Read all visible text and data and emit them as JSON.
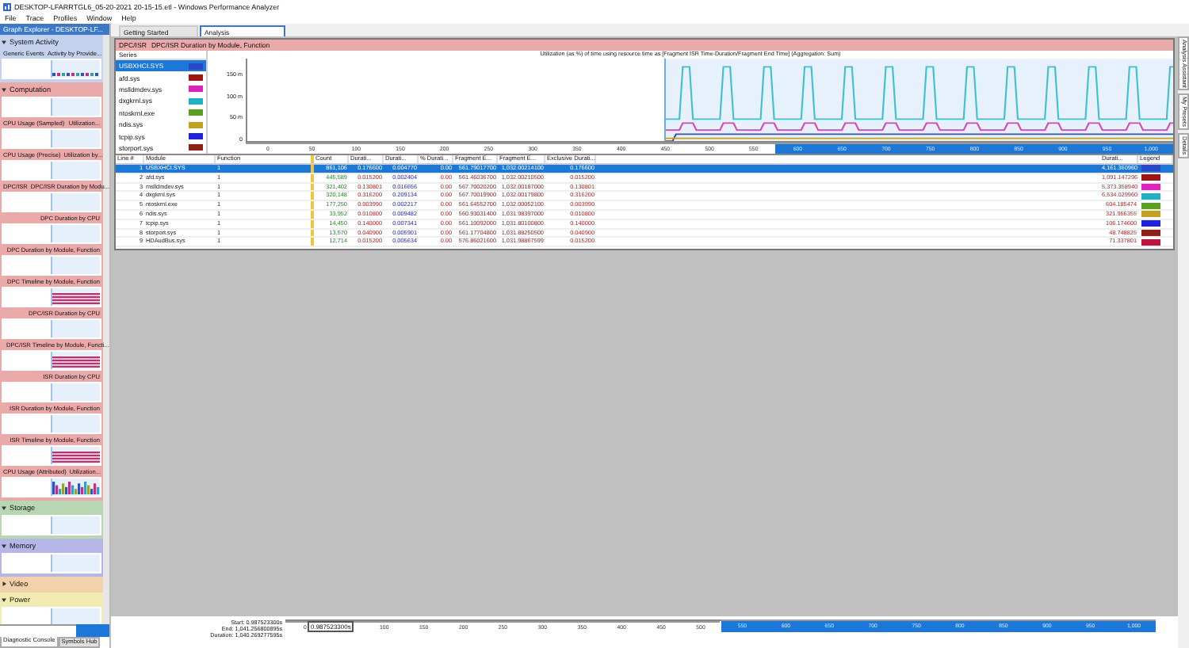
{
  "window": {
    "title": "DESKTOP-LFARRTGL6_05-20-2021 20-15-15.etl - Windows Performance Analyzer"
  },
  "menu": [
    "File",
    "Trace",
    "Profiles",
    "Window",
    "Help"
  ],
  "graph_explorer": {
    "title": "Graph Explorer - DESKTOP-LF...",
    "sections": [
      {
        "name": "System Activity",
        "expanded": true,
        "color": "#c4d2ee",
        "graphs": [
          {
            "title": "Generic Events",
            "subtitle": "Activity by Provide...",
            "kind": "activity"
          }
        ]
      },
      {
        "name": "Computation",
        "expanded": true,
        "color": "#eaaaaa",
        "graphs": [
          {
            "kind": "empty"
          },
          {
            "title": "CPU Usage (Sampled)",
            "subtitle": "Utilization...",
            "kind": "empty"
          },
          {
            "title": "CPU Usage (Precise)",
            "subtitle": "Utilization by...",
            "kind": "empty"
          },
          {
            "title": "DPC/ISR",
            "subtitle": "DPC/ISR Duration by Modu...",
            "kind": "empty"
          },
          {
            "subtitle": "DPC Duration by CPU",
            "kind": "empty"
          },
          {
            "subtitle": "DPC Duration by Module, Function",
            "kind": "empty"
          },
          {
            "subtitle": "DPC Timeline by Module, Function",
            "kind": "stripes"
          },
          {
            "subtitle": "DPC/ISR Duration by CPU",
            "kind": "empty"
          },
          {
            "subtitle": "DPC/ISR Timeline by Module, Functi...",
            "kind": "stripes"
          },
          {
            "subtitle": "ISR Duration by CPU",
            "kind": "empty"
          },
          {
            "subtitle": "ISR Duration by Module, Function",
            "kind": "empty"
          },
          {
            "subtitle": "ISR Timeline by Module, Function",
            "kind": "stripes"
          },
          {
            "title": "CPU Usage (Attributed)",
            "subtitle": "Utilization...",
            "kind": "bars"
          }
        ]
      },
      {
        "name": "Storage",
        "expanded": true,
        "color": "#b9d6b2",
        "graphs": [
          {
            "kind": "empty"
          }
        ]
      },
      {
        "name": "Memory",
        "expanded": true,
        "color": "#b6b6e6",
        "graphs": [
          {
            "kind": "empty"
          }
        ]
      },
      {
        "name": "Video",
        "expanded": false,
        "color": "#f2d2aa"
      },
      {
        "name": "Power",
        "expanded": true,
        "color": "#f2ecb2",
        "graphs": [
          {
            "kind": "empty"
          }
        ]
      }
    ]
  },
  "bottom_tabs": [
    {
      "label": "Diagnostic Console",
      "selected": true
    },
    {
      "label": "Symbols Hub",
      "selected": false
    }
  ],
  "tabs": [
    {
      "label": "Getting Started",
      "selected": false
    },
    {
      "label": "Analysis",
      "selected": true
    }
  ],
  "analysis": {
    "graph_title": "DPC/ISR",
    "graph_subtitle": "DPC/ISR Duration by Module, Function",
    "series_header": "Series",
    "series": [
      {
        "name": "USBXHCI.SYS",
        "color": "#2a48c8",
        "selected": true
      },
      {
        "name": "afd.sys",
        "color": "#a01414",
        "selected": false
      },
      {
        "name": "mslldmdev.sys",
        "color": "#e020c0",
        "selected": false
      },
      {
        "name": "dxgkrnl.sys",
        "color": "#20b0c4",
        "selected": false
      },
      {
        "name": "ntoskrnl.exe",
        "color": "#58a020",
        "selected": false
      },
      {
        "name": "ndis.sys",
        "color": "#c4a020",
        "selected": false
      },
      {
        "name": "tcpip.sys",
        "color": "#2020e0",
        "selected": false
      },
      {
        "name": "storport.sys",
        "color": "#902014",
        "selected": false
      }
    ],
    "chart": {
      "title": "Utilization (as %) of time using resource time as [Fragment ISR Time-Duration/Fragment End Time] (Aggregation: Sum)",
      "y_ticks": [
        "150 m",
        "100 m",
        "50 m",
        "0"
      ],
      "x_ticks": [
        "0",
        "50",
        "100",
        "150",
        "200",
        "250",
        "300",
        "350",
        "400",
        "450",
        "500",
        "550",
        "600",
        "650",
        "700",
        "750",
        "800",
        "850",
        "900",
        "950",
        "1,000"
      ]
    },
    "table": {
      "columns": [
        "Line #",
        "Module",
        "Function",
        "Count",
        "Durati...",
        "Durati...",
        "% Durati...",
        "Fragment E...",
        "Fragment E...",
        "Exclusive Durati...",
        "Durati...",
        "Legend"
      ],
      "rows": [
        {
          "selected": true,
          "color": "#2a48c8",
          "cells": [
            "1",
            "USBXHCI.SYS",
            "1",
            "861,106",
            "0.176600",
            "0.004770",
            "0.00",
            "561.79017700",
            "1,032.00214100",
            "0.176600",
            "4,161.360960"
          ]
        },
        {
          "selected": false,
          "color": "#a01414",
          "cells": [
            "2",
            "afd.sys",
            "1",
            "445,589",
            "0.015200",
            "0.002404",
            "0.00",
            "561.46036700",
            "1,032.00210500",
            "0.015200",
            "1,091.147296"
          ]
        },
        {
          "selected": false,
          "color": "#e020c0",
          "cells": [
            "3",
            "mslldmdev.sys",
            "1",
            "321,402",
            "0.130801",
            "0.016656",
            "0.00",
            "567.70020200",
            "1,032.00187000",
            "0.130801",
            "5,373.358940"
          ]
        },
        {
          "selected": false,
          "color": "#20b0c4",
          "cells": [
            "4",
            "dxgkrnl.sys",
            "1",
            "320,148",
            "0.316200",
            "0.209134",
            "0.00",
            "567.70019900",
            "1,032.00179800",
            "0.316200",
            "6,534.029960"
          ]
        },
        {
          "selected": false,
          "color": "#58a020",
          "cells": [
            "5",
            "ntoskrnl.exe",
            "1",
            "177,250",
            "0.003990",
            "0.002217",
            "0.00",
            "561.64552700",
            "1,032.00052100",
            "0.003990",
            "604.185474"
          ]
        },
        {
          "selected": false,
          "color": "#c4a020",
          "cells": [
            "6",
            "ndis.sys",
            "1",
            "33,952",
            "0.010800",
            "0.009482",
            "0.00",
            "560.93031400",
            "1,031.98397000",
            "0.010800",
            "321.956355"
          ]
        },
        {
          "selected": false,
          "color": "#2020e0",
          "cells": [
            "7",
            "tcpip.sys",
            "1",
            "14,450",
            "0.140000",
            "0.007341",
            "0.00",
            "561.10092000",
            "1,031.80100800",
            "0.140000",
            "106.174600"
          ]
        },
        {
          "selected": false,
          "color": "#902014",
          "cells": [
            "8",
            "storport.sys",
            "1",
            "13,570",
            "0.040900",
            "0.005901",
            "0.00",
            "561.17704800",
            "1,031.88250500",
            "0.040900",
            "48.748825"
          ]
        },
        {
          "selected": false,
          "color": "#c01440",
          "cells": [
            "9",
            "HDAudBus.sys",
            "1",
            "12,714",
            "0.015200",
            "0.005634",
            "0.00",
            "576.86021600",
            "1,031.98867599",
            "0.015200",
            "71.337801"
          ]
        }
      ]
    }
  },
  "timeline": {
    "labels": [
      {
        "name": "Start:",
        "value": "0.987523300s"
      },
      {
        "name": "End:",
        "value": "1,041.256800895s"
      },
      {
        "name": "Duration:",
        "value": "1,040.269277595s"
      }
    ],
    "marker": "0.987523300s",
    "ticks": [
      "0",
      "100",
      "150",
      "200",
      "250",
      "300",
      "350",
      "400",
      "450",
      "500",
      "550",
      "600",
      "650",
      "700",
      "750",
      "800",
      "850",
      "900",
      "950",
      "1,000"
    ]
  },
  "side_tabs": [
    "Analysis Assistant",
    "My Presets",
    "Details"
  ]
}
